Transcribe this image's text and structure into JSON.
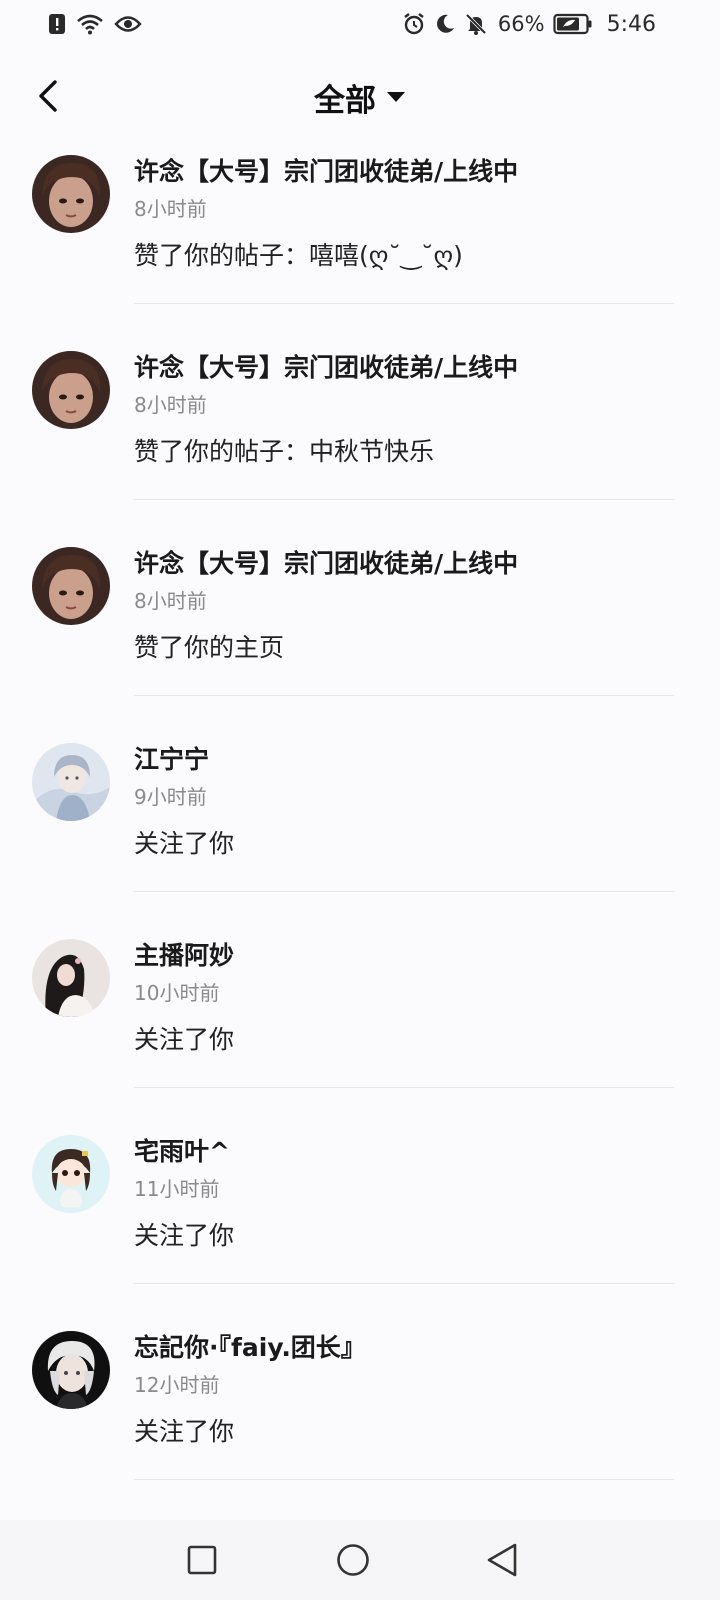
{
  "status_bar": {
    "battery_percent": "66%",
    "time": "5:46",
    "icons": [
      "alert-icon",
      "wifi-icon",
      "eye-icon",
      "alarm-icon",
      "moon-icon",
      "mute-bell-icon",
      "battery-icon"
    ]
  },
  "header": {
    "back_icon": "back-chevron-icon",
    "filter_label": "全部",
    "filter_icon": "dropdown-triangle-icon"
  },
  "notifications": [
    {
      "user": "许念【大号】宗门团收徒弟/上线中",
      "time": "8小时前",
      "action": "赞了你的帖子：嘻嘻(ღ˘‿˘ღ)",
      "avatar": "avatar-girl-brown-hair"
    },
    {
      "user": "许念【大号】宗门团收徒弟/上线中",
      "time": "8小时前",
      "action": "赞了你的帖子：中秋节快乐",
      "avatar": "avatar-girl-brown-hair"
    },
    {
      "user": "许念【大号】宗门团收徒弟/上线中",
      "time": "8小时前",
      "action": "赞了你的主页",
      "avatar": "avatar-girl-brown-hair"
    },
    {
      "user": "江宁宁",
      "time": "9小时前",
      "action": "关注了你",
      "avatar": "avatar-anime-light"
    },
    {
      "user": "主播阿妙",
      "time": "10小时前",
      "action": "关注了你",
      "avatar": "avatar-girl-dark-hair"
    },
    {
      "user": "宅雨叶^",
      "time": "11小时前",
      "action": "关注了你",
      "avatar": "avatar-chibi"
    },
    {
      "user": "忘記你·『faiy.团长』",
      "time": "12小时前",
      "action": "关注了你",
      "avatar": "avatar-white-hair"
    }
  ],
  "nav_bar": {
    "buttons": [
      "recents-square-icon",
      "home-circle-icon",
      "back-triangle-icon"
    ]
  },
  "colors": {
    "background": "#fbfbfd",
    "divider": "#e8e8ec",
    "secondary_text": "#8a8a8a",
    "nav_bar": "#f6f6f8"
  }
}
